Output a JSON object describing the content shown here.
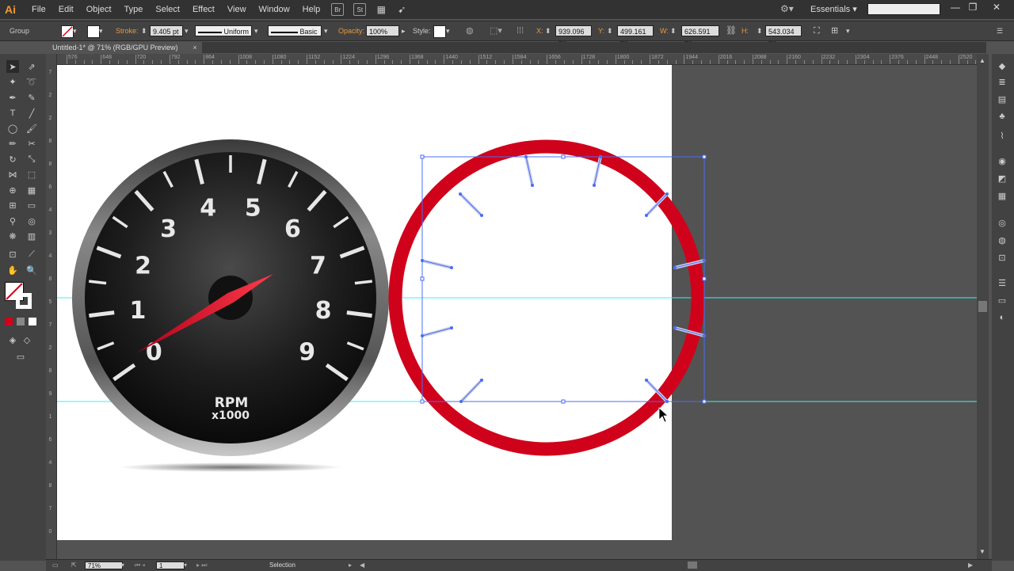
{
  "app": {
    "logo": "Ai",
    "menus": [
      "File",
      "Edit",
      "Object",
      "Type",
      "Select",
      "Effect",
      "View",
      "Window",
      "Help"
    ],
    "menu_icons": [
      "Br",
      "St",
      "arrange-documents-icon",
      "gpu-icon"
    ],
    "workspace": "Essentials",
    "window_controls": [
      "minimize",
      "restore",
      "close"
    ]
  },
  "control_bar": {
    "selection_type": "Group",
    "stroke_label": "Stroke:",
    "stroke_weight": "9.405 pt",
    "profile": "Uniform",
    "brush": "Basic",
    "opacity_label": "Opacity:",
    "opacity": "100%",
    "style_label": "Style:",
    "x_label": "X:",
    "x": "939.096 px",
    "y_label": "Y:",
    "y": "499.161 px",
    "w_label": "W:",
    "w": "626.591 px",
    "h_label": "H:",
    "h": "543.034 px"
  },
  "document": {
    "tab_title": "Untitled-1* @ 71% (RGB/GPU Preview)",
    "close_glyph": "×"
  },
  "ruler": {
    "h_labels": [
      "576",
      "648",
      "720",
      "792",
      "864",
      "1008",
      "1080",
      "1152",
      "1224",
      "1296",
      "1368",
      "1440",
      "1512",
      "1584",
      "1656",
      "1728",
      "1800",
      "1872",
      "1944",
      "2016",
      "2088",
      "2160",
      "2232",
      "2304",
      "2376",
      "2448",
      "2520"
    ],
    "v_labels": [
      "7",
      "2",
      "2",
      "8",
      "8",
      "6",
      "4",
      "3",
      "4",
      "8",
      "5",
      "7",
      "2",
      "8",
      "9",
      "1",
      "6",
      "4",
      "8",
      "7",
      "0"
    ]
  },
  "tachometer": {
    "numbers": [
      "0",
      "1",
      "2",
      "3",
      "4",
      "5",
      "6",
      "7",
      "8",
      "9"
    ],
    "unit_line1": "RPM",
    "unit_line2": "x1000",
    "needle_value": 0.6
  },
  "colors": {
    "accent_red": "#d0021b",
    "selection_blue": "#4a6cf7",
    "guide_cyan": "#3ff0f0",
    "gauge_face": "#1a1a1a"
  },
  "statusbar": {
    "zoom": "71%",
    "artboard_number": "1",
    "tool_name": "Selection"
  }
}
